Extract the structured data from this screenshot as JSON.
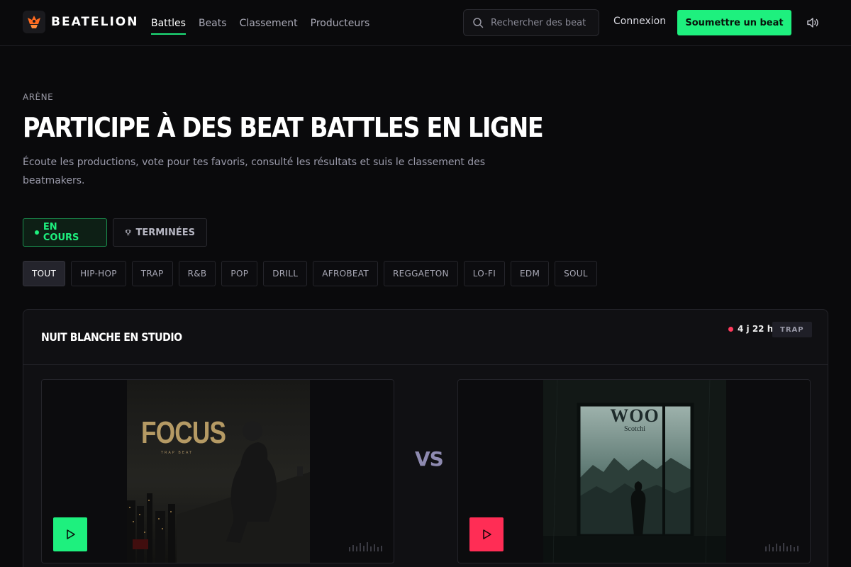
{
  "brand": {
    "name": "BEATELION",
    "accent": "#1ef07e",
    "icon": "flame-crown-icon"
  },
  "nav": [
    {
      "label": "Battles",
      "active": true
    },
    {
      "label": "Beats",
      "active": false
    },
    {
      "label": "Classement",
      "active": false
    },
    {
      "label": "Producteurs",
      "active": false
    }
  ],
  "search": {
    "placeholder": "Rechercher des beat",
    "icon": "search-icon"
  },
  "header": {
    "login_label": "Connexion",
    "submit_label": "Soumettre un beat",
    "sound_icon": "speaker-icon"
  },
  "hero": {
    "eyebrow": "ARÈNE",
    "title": "PARTICIPE À DES BEAT BATTLES EN LIGNE",
    "subtitle": "Écoute les productions, vote pour tes favoris, consulté les résultats et suis le classement des beatmakers."
  },
  "status_tabs": {
    "live": "EN COURS",
    "done": "TERMINÉES"
  },
  "genres": [
    "TOUT",
    "HIP-HOP",
    "TRAP",
    "R&B",
    "POP",
    "DRILL",
    "AFROBEAT",
    "REGGAETON",
    "LO-FI",
    "EDM",
    "SOUL"
  ],
  "battle": {
    "title": "NUIT BLANCHE EN STUDIO",
    "time_left": "4 j 22 h",
    "genre": "TRAP",
    "vs_label": "VS",
    "entry_a": {
      "cover_title": "FOCUS",
      "cover_subtitle": "TRAP BEAT",
      "play_color": "#1ef07e"
    },
    "entry_b": {
      "cover_title": "WOO",
      "cover_subtitle": "Scotchi",
      "play_color": "#ff2d55"
    }
  }
}
